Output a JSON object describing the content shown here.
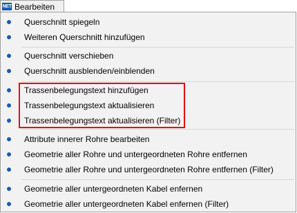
{
  "menu": {
    "icon_text": "NET",
    "title": "Bearbeiten"
  },
  "items": [
    {
      "label": "Querschnitt spiegeln"
    },
    {
      "label": "Weiteren Querschnitt hinzufügen"
    },
    {
      "label": "Querschnitt verschieben"
    },
    {
      "label": "Querschnitt ausblenden/einblenden"
    },
    {
      "label": "Trassenbelegungstext hinzufügen"
    },
    {
      "label": "Trassenbelegungstext aktualisieren"
    },
    {
      "label": "Trassenbelegungstext aktualisieren (Filter)"
    },
    {
      "label": "Attribute innerer Rohre bearbeiten"
    },
    {
      "label": "Geometrie aller Rohre und untergeordneten Rohre entfernen"
    },
    {
      "label": "Geometrie aller Rohre und untergeordneten Rohre entfernen (Filter)"
    },
    {
      "label": "Geometrie aller untergeordneten Kabel enfernen"
    },
    {
      "label": "Geometrie aller untergeordneten Kabel enfernen (Filter)"
    }
  ],
  "colors": {
    "bullet": "#1f5aa6",
    "highlight_border": "#e01010",
    "menu_background": "#f2f2f2"
  }
}
